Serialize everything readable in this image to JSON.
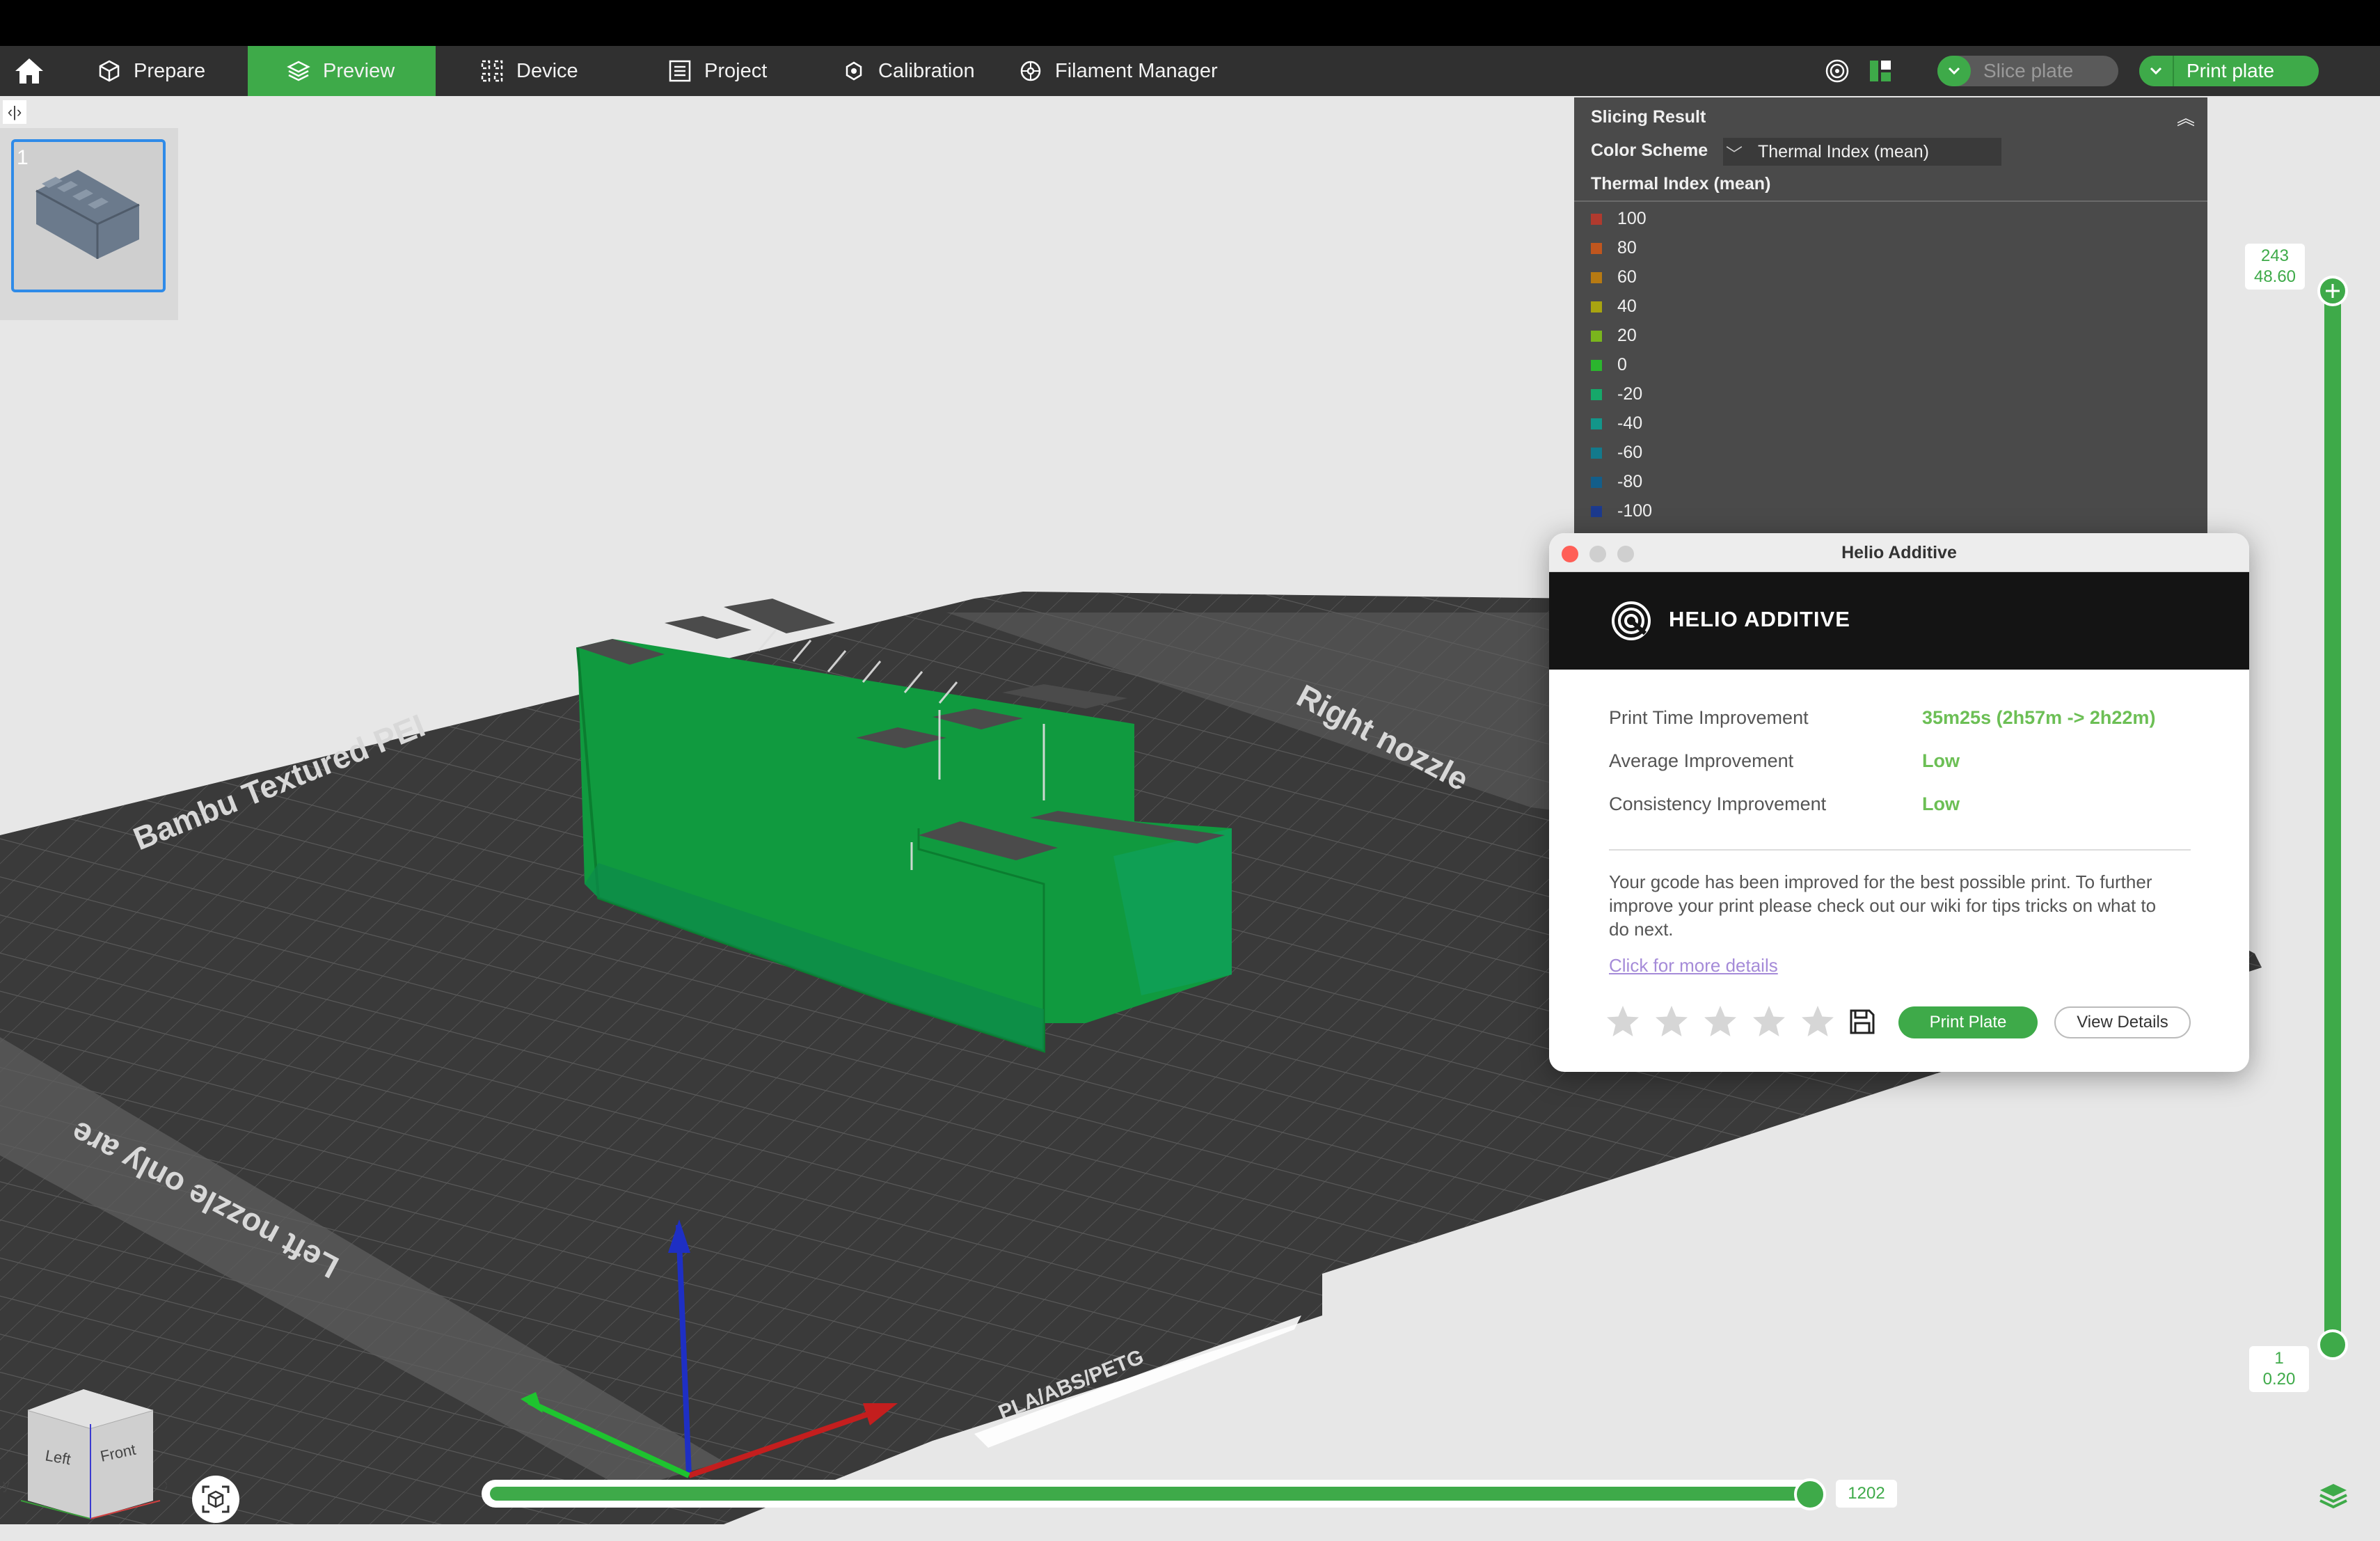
{
  "nav": {
    "home_icon": "home-icon",
    "tabs": [
      {
        "label": "Prepare",
        "icon": "cube-icon"
      },
      {
        "label": "Preview",
        "icon": "layers-icon"
      },
      {
        "label": "Device",
        "icon": "device-icon"
      },
      {
        "label": "Project",
        "icon": "project-icon"
      },
      {
        "label": "Calibration",
        "icon": "calibration-icon"
      },
      {
        "label": "Filament Manager",
        "icon": "filament-icon"
      }
    ],
    "active_tab": "Preview",
    "slice_label": "Slice plate",
    "print_label": "Print plate",
    "accent": "#3eaa49"
  },
  "plate": {
    "number": "1"
  },
  "slicing": {
    "title": "Slicing Result",
    "color_scheme_label": "Color Scheme",
    "color_scheme_value": "Thermal Index (mean)",
    "legend_title": "Thermal Index (mean)",
    "legend": [
      {
        "value": "100",
        "color": "#b03a2e"
      },
      {
        "value": "80",
        "color": "#c0561e"
      },
      {
        "value": "60",
        "color": "#b77a12"
      },
      {
        "value": "40",
        "color": "#a8a410"
      },
      {
        "value": "20",
        "color": "#7ab51d"
      },
      {
        "value": "0",
        "color": "#2bb52e"
      },
      {
        "value": "-20",
        "color": "#16a86a"
      },
      {
        "value": "-40",
        "color": "#13968a"
      },
      {
        "value": "-60",
        "color": "#137a8c"
      },
      {
        "value": "-80",
        "color": "#135e8a"
      },
      {
        "value": "-100",
        "color": "#1c3a8e"
      }
    ]
  },
  "helio": {
    "window_title": "Helio Additive",
    "brand": "HELIO ADDITIVE",
    "stats": [
      {
        "label": "Print Time Improvement",
        "value": "35m25s (2h57m -> 2h22m)"
      },
      {
        "label": "Average Improvement",
        "value": "Low"
      },
      {
        "label": "Consistency Improvement",
        "value": "Low"
      }
    ],
    "message": "Your gcode has been improved for the best possible print. To further improve your print please check out our wiki for tips tricks on what to do next.",
    "link": "Click for more details",
    "rating": 0,
    "print_button": "Print Plate",
    "details_button": "View Details"
  },
  "layer_slider": {
    "top_layer": "243",
    "top_height": "48.60",
    "bottom_layer": "1",
    "bottom_height": "0.20"
  },
  "move_slider": {
    "value": "1202"
  },
  "bed": {
    "label_top": "Bambu Textured PEI",
    "label_right": "Right nozzle",
    "label_left": "Left nozzle only are",
    "label_bottom": "PLA/ABS/PETG"
  },
  "view_cube": {
    "left": "Left",
    "front": "Front",
    "x_axis": "x",
    "y_axis": "y"
  }
}
